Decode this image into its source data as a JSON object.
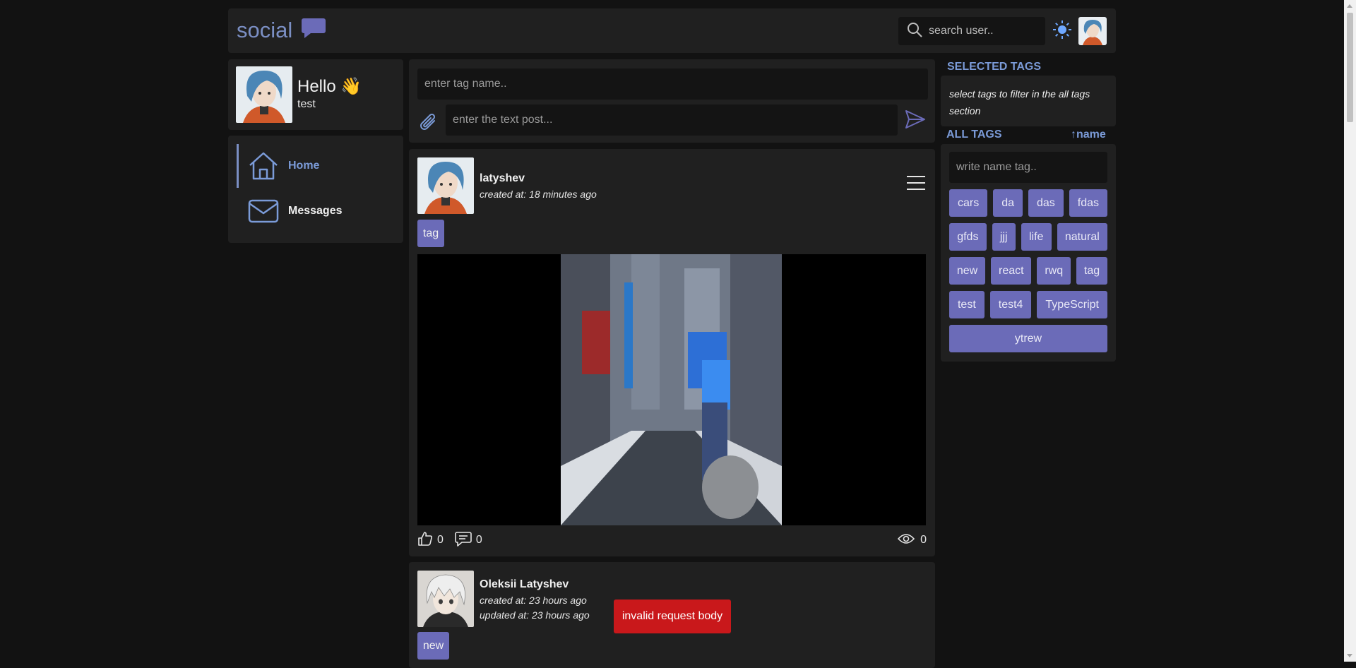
{
  "header": {
    "logo_text": "social",
    "logo_icon": "chat-bubble-icon",
    "search_placeholder": "search user..",
    "theme_icon": "sun-icon"
  },
  "profile": {
    "greeting": "Hello 👋",
    "username": "test"
  },
  "nav": {
    "items": [
      {
        "label": "Home",
        "icon": "home-icon",
        "active": true
      },
      {
        "label": "Messages",
        "icon": "envelope-icon",
        "active": false
      }
    ]
  },
  "composer": {
    "tag_placeholder": "enter tag name..",
    "text_placeholder": "enter the text post..."
  },
  "posts": [
    {
      "author": "latyshev",
      "created": "created at: 18 minutes ago",
      "tags": [
        "tag"
      ],
      "likes": "0",
      "comments": "0",
      "views": "0"
    },
    {
      "author": "Oleksii Latyshev",
      "created": "created at: 23 hours ago",
      "updated": "updated at: 23 hours ago",
      "tags": [
        "new"
      ],
      "error": "invalid request body"
    }
  ],
  "sidebar": {
    "selected_heading": "SELECTED TAGS",
    "selected_hint": "select tags to filter in the all tags section",
    "all_heading": "ALL TAGS",
    "sort_label": "↑name",
    "tag_search_placeholder": "write name tag..",
    "tags": [
      [
        "cars",
        "da",
        "das",
        "fdas"
      ],
      [
        "gfds",
        "jjj",
        "life",
        "natural"
      ],
      [
        "new",
        "react",
        "rwq",
        "tag"
      ],
      [
        "test",
        "test4",
        "TypeScript"
      ],
      [
        "ytrew"
      ]
    ]
  },
  "colors": {
    "accent": "#6b6bb8",
    "link": "#7b9bd8",
    "error": "#c9181b",
    "panel": "#202020",
    "background": "#121212"
  }
}
